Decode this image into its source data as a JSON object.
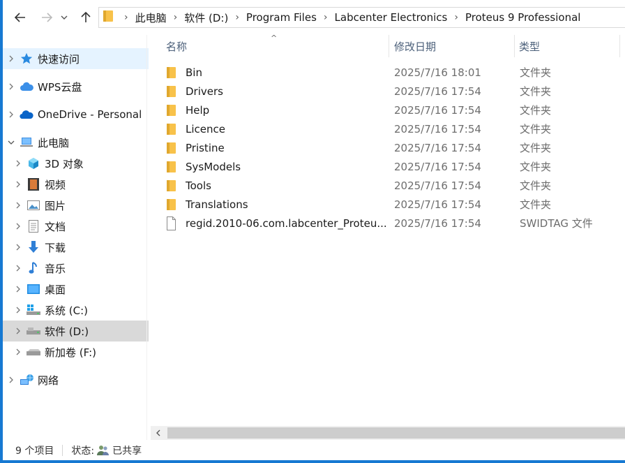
{
  "address": {
    "crumbs": [
      "此电脑",
      "软件 (D:)",
      "Program Files",
      "Labcenter Electronics",
      "Proteus 9 Professional"
    ]
  },
  "sidebar": {
    "items": [
      {
        "label": "快速访问",
        "icon": "star-icon"
      },
      {
        "label": "WPS云盘",
        "icon": "wps-cloud-icon"
      },
      {
        "label": "OneDrive - Personal",
        "icon": "onedrive-cloud-icon"
      },
      {
        "label": "此电脑",
        "icon": "this-pc-icon"
      },
      {
        "label": "3D 对象",
        "icon": "3d-objects-icon"
      },
      {
        "label": "视频",
        "icon": "video-icon"
      },
      {
        "label": "图片",
        "icon": "pictures-icon"
      },
      {
        "label": "文档",
        "icon": "documents-icon"
      },
      {
        "label": "下载",
        "icon": "download-icon"
      },
      {
        "label": "音乐",
        "icon": "music-icon"
      },
      {
        "label": "桌面",
        "icon": "desktop-icon"
      },
      {
        "label": "系统 (C:)",
        "icon": "windows-drive-icon"
      },
      {
        "label": "软件 (D:)",
        "icon": "drive-icon"
      },
      {
        "label": "新加卷 (F:)",
        "icon": "drive-icon"
      },
      {
        "label": "网络",
        "icon": "network-icon"
      }
    ]
  },
  "columns": {
    "name": "名称",
    "date": "修改日期",
    "type": "类型"
  },
  "files": [
    {
      "name": "Bin",
      "date": "2025/7/16 18:01",
      "type": "文件夹",
      "icon": "folder-icon"
    },
    {
      "name": "Drivers",
      "date": "2025/7/16 17:54",
      "type": "文件夹",
      "icon": "folder-icon"
    },
    {
      "name": "Help",
      "date": "2025/7/16 17:54",
      "type": "文件夹",
      "icon": "folder-icon"
    },
    {
      "name": "Licence",
      "date": "2025/7/16 17:54",
      "type": "文件夹",
      "icon": "folder-icon"
    },
    {
      "name": "Pristine",
      "date": "2025/7/16 17:54",
      "type": "文件夹",
      "icon": "folder-icon"
    },
    {
      "name": "SysModels",
      "date": "2025/7/16 17:54",
      "type": "文件夹",
      "icon": "folder-icon"
    },
    {
      "name": "Tools",
      "date": "2025/7/16 17:54",
      "type": "文件夹",
      "icon": "folder-icon"
    },
    {
      "name": "Translations",
      "date": "2025/7/16 17:54",
      "type": "文件夹",
      "icon": "folder-icon"
    },
    {
      "name": "regid.2010-06.com.labcenter_Proteu...",
      "date": "2025/7/16 17:54",
      "type": "SWIDTAG 文件",
      "icon": "file-icon"
    }
  ],
  "status": {
    "count": "9 个项目",
    "state_label": "状态:",
    "state_value": "已共享"
  },
  "colors": {
    "accent": "#1779d2",
    "folder": "#f8c24a",
    "hover": "#e5f3ff",
    "selected": "#d9d9d9"
  }
}
